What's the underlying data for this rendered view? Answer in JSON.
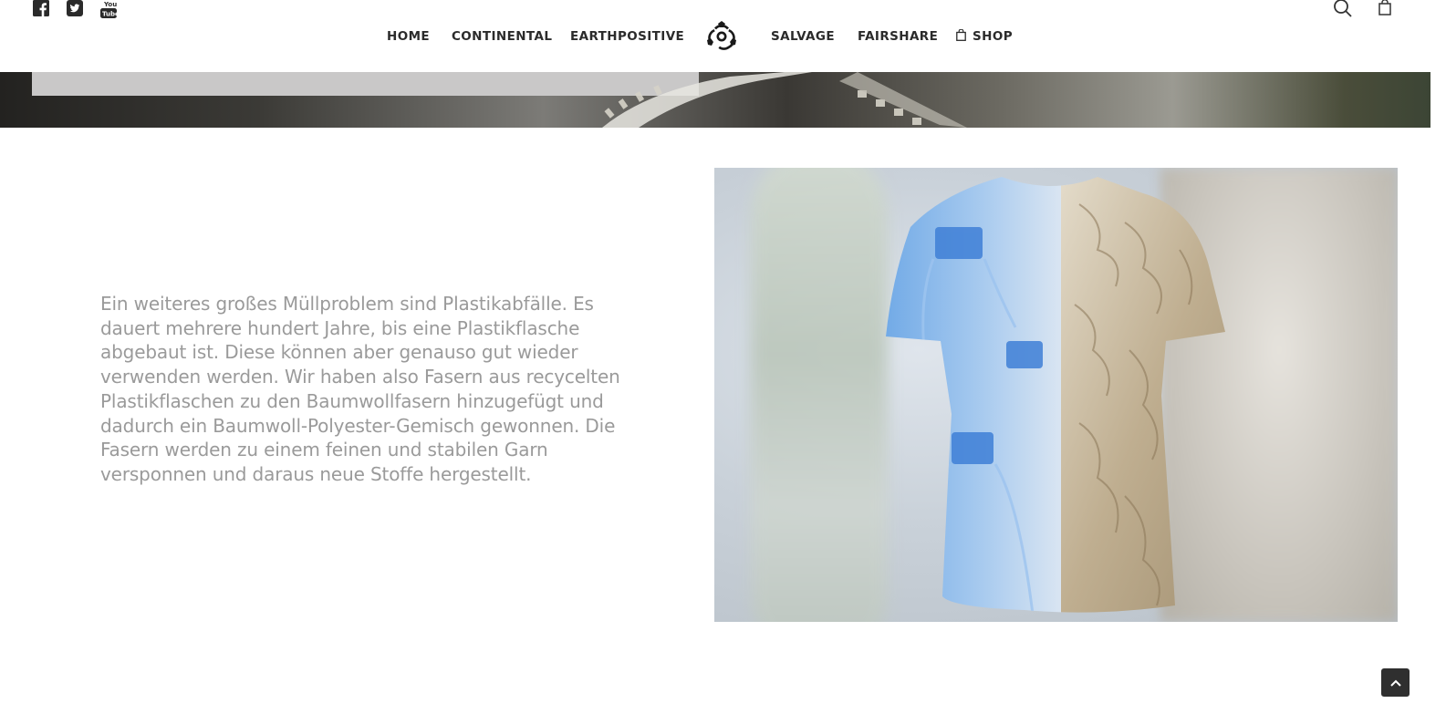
{
  "social": {
    "icons": [
      "facebook-icon",
      "twitter-icon",
      "youtube-icon"
    ]
  },
  "nav": {
    "items": [
      {
        "label": "HOME"
      },
      {
        "label": "CONTINENTAL"
      },
      {
        "label": "EARTHPOSITIVE"
      },
      {
        "label": "SALVAGE"
      },
      {
        "label": "FAIRSHARE"
      },
      {
        "label": "SHOP"
      }
    ],
    "logo_icon": "biohazard-logo-icon"
  },
  "header_right": {
    "icons": [
      "search-icon",
      "shopping-bag-icon"
    ]
  },
  "content": {
    "description": "Ein weiteres großes Müllproblem sind Plastikabfälle. Es dauert mehrere hundert Jahre, bis eine Plastikflasche abgebaut ist. Diese können aber genauso gut wieder verwenden werden. Wir haben also Fasern aus recycelten Plastikflaschen zu den Baumwollfasern hinzugefügt und dadurch ein Baumwoll-Polyester-Gemisch gewonnen. Die Fasern werden zu einem feinen und stabilen Garn versponnen und daraus neue Stoffe hergestellt."
  },
  "colors": {
    "nav_text": "#2b2b2b",
    "body_text": "#9a9a9a",
    "to_top_bg": "#2f2f2f"
  }
}
